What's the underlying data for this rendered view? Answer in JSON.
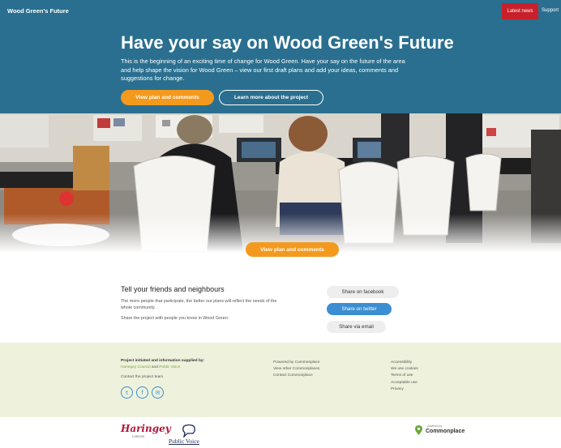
{
  "header": {
    "brand": "Wood Green's Future",
    "nav_latest": "Latest news",
    "nav_support": "Support"
  },
  "hero": {
    "title": "Have your say on Wood Green's Future",
    "text": "This is the beginning of an exciting time of change for Wood Green. Have your say on the future of the area and help shape the vision for Wood Green – view our first draft plans and add your ideas, comments and suggestions for change.",
    "primary_button": "View plan and comments",
    "secondary_button": "Learn more about the project"
  },
  "photo_button": "View plan and comments",
  "share": {
    "title": "Tell your friends and neighbours",
    "text": "The more people that participate, the better our plans will reflect the needs of the whole community.",
    "text2": "Share the project with people you know in Wood Green:",
    "facebook": "Share on facebook",
    "twitter": "Share on twitter",
    "email": "Share via email"
  },
  "footer": {
    "col1": {
      "line1": "Project initiated and information supplied by:",
      "haringey": "Haringey Council",
      "and": " and ",
      "public_voice": "Public Voice",
      "contact": "Contact the project team"
    },
    "col2": [
      "Powered by Commonplace",
      "View other Commonplaces",
      "Contact Commonplace"
    ],
    "col3": [
      "Accessibility",
      "We use cookies",
      "Terms of use",
      "Acceptable use",
      "Privacy"
    ],
    "social": {
      "twitter": "t",
      "facebook": "f",
      "email": "✉"
    }
  },
  "logos": {
    "haringey": "Haringey",
    "haringey_sub": "LONDON",
    "public_voice": "Public Voice",
    "commonplace_small": "powered by",
    "commonplace": "Commonplace"
  },
  "colors": {
    "header_bg": "#2a6f8f",
    "accent_orange": "#f39a1e",
    "news_red": "#c8202a",
    "twitter_blue": "#3b8ed1",
    "footer_bg": "#eef2dc"
  }
}
